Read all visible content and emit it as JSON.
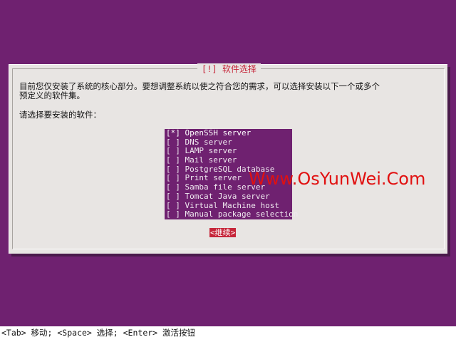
{
  "dialog": {
    "title": "[!] 软件选择",
    "description": "目前您仅安装了系统的核心部分。要想调整系统以使之符合您的需求，可以选择安装以下一个或多个\n预定义的软件集。",
    "prompt": "请选择要安装的软件：",
    "items": [
      {
        "label": "[*] OpenSSH server",
        "checked": true
      },
      {
        "label": "[ ] DNS server",
        "checked": false
      },
      {
        "label": "[ ] LAMP server",
        "checked": false
      },
      {
        "label": "[ ] Mail server",
        "checked": false
      },
      {
        "label": "[ ] PostgreSQL database",
        "checked": false
      },
      {
        "label": "[ ] Print server",
        "checked": false
      },
      {
        "label": "[ ] Samba file server",
        "checked": false
      },
      {
        "label": "[ ] Tomcat Java server",
        "checked": false
      },
      {
        "label": "[ ] Virtual Machine host",
        "checked": false
      },
      {
        "label": "[ ] Manual package selection",
        "checked": false
      }
    ],
    "continue_label": "<继续>"
  },
  "watermark": "Www.OsYunWei.Com",
  "statusbar": "<Tab> 移动; <Space> 选择; <Enter> 激活按钮",
  "colors": {
    "background": "#6f2170",
    "dialog": "#e8e5e3",
    "accent": "#c6263a",
    "watermark": "#e11010"
  }
}
